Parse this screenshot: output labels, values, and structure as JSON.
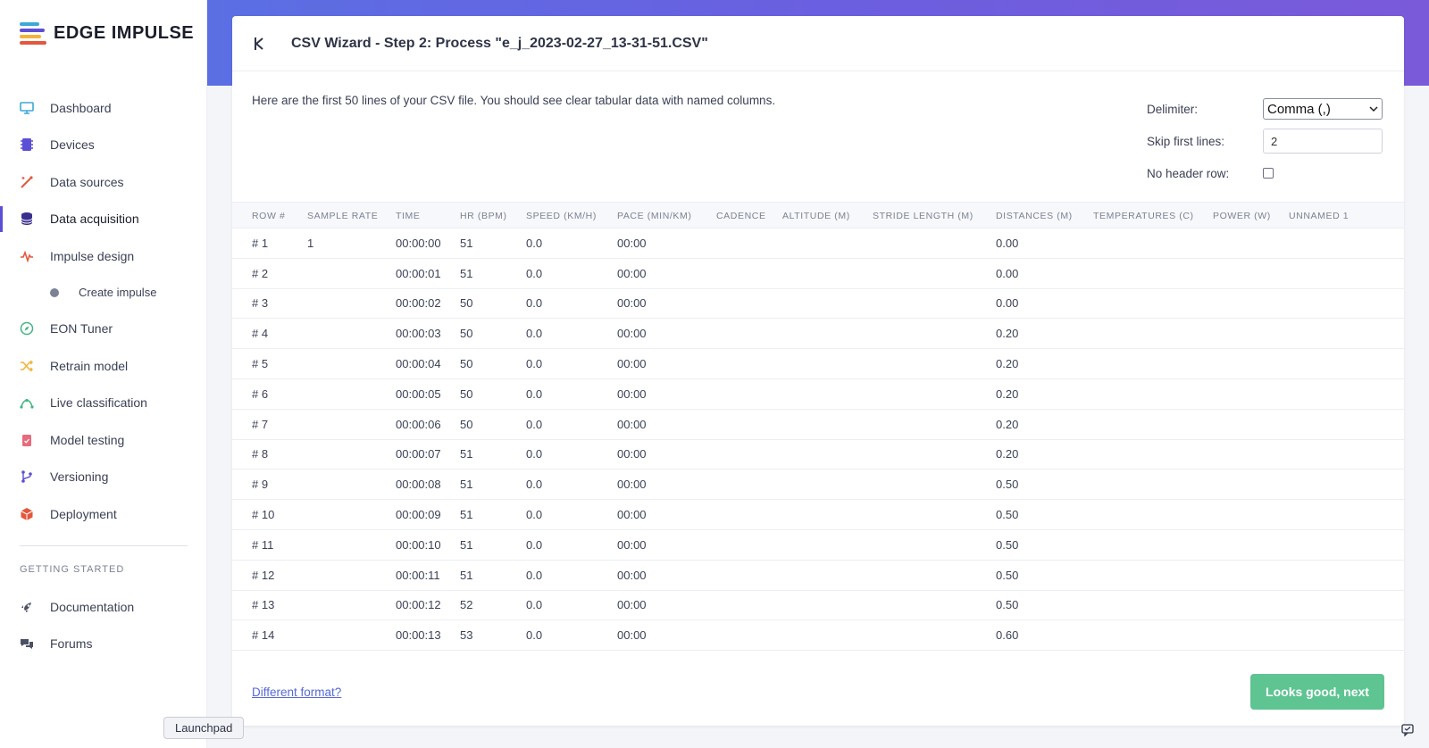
{
  "app": {
    "name": "EDGE IMPULSE",
    "colors": {
      "accent": "#5b4fd6",
      "primary_button": "#5ec491",
      "link": "#5668d6"
    }
  },
  "sidebar": {
    "items": [
      {
        "label": "Dashboard",
        "icon": "monitor-icon"
      },
      {
        "label": "Devices",
        "icon": "chip-icon"
      },
      {
        "label": "Data sources",
        "icon": "wand-icon"
      },
      {
        "label": "Data acquisition",
        "icon": "database-icon",
        "active": true
      },
      {
        "label": "Impulse design",
        "icon": "pulse-icon"
      }
    ],
    "sub_item": "Create impulse",
    "items_after": [
      {
        "label": "EON Tuner",
        "icon": "compass-icon"
      },
      {
        "label": "Retrain model",
        "icon": "shuffle-icon"
      },
      {
        "label": "Live classification",
        "icon": "curve-icon"
      },
      {
        "label": "Model testing",
        "icon": "clipboard-icon"
      },
      {
        "label": "Versioning",
        "icon": "branch-icon"
      },
      {
        "label": "Deployment",
        "icon": "box-icon"
      }
    ],
    "section_label": "GETTING STARTED",
    "getting_started": [
      {
        "label": "Documentation",
        "icon": "rocket-icon"
      },
      {
        "label": "Forums",
        "icon": "chat-icon"
      }
    ]
  },
  "wizard": {
    "title": "CSV Wizard - Step 2: Process \"e_j_2023-02-27_13-31-51.CSV\"",
    "intro": "Here are the first 50 lines of your CSV file. You should see clear tabular data with named columns.",
    "delimiter_label": "Delimiter:",
    "delimiter_value": "Comma (,)",
    "skip_label": "Skip first lines:",
    "skip_value": "2",
    "no_header_label": "No header row:",
    "no_header_checked": false,
    "columns": [
      "ROW #",
      "SAMPLE RATE",
      "TIME",
      "HR (BPM)",
      "SPEED (KM/H)",
      "PACE (MIN/KM)",
      "CADENCE",
      "ALTITUDE (M)",
      "STRIDE LENGTH (M)",
      "DISTANCES (M)",
      "TEMPERATURES (C)",
      "POWER (W)",
      "UNNAMED 1"
    ],
    "rows": [
      [
        "# 1",
        "1",
        "00:00:00",
        "51",
        "0.0",
        "00:00",
        "",
        "",
        "",
        "0.00",
        "",
        "",
        ""
      ],
      [
        "# 2",
        "",
        "00:00:01",
        "51",
        "0.0",
        "00:00",
        "",
        "",
        "",
        "0.00",
        "",
        "",
        ""
      ],
      [
        "# 3",
        "",
        "00:00:02",
        "50",
        "0.0",
        "00:00",
        "",
        "",
        "",
        "0.00",
        "",
        "",
        ""
      ],
      [
        "# 4",
        "",
        "00:00:03",
        "50",
        "0.0",
        "00:00",
        "",
        "",
        "",
        "0.20",
        "",
        "",
        ""
      ],
      [
        "# 5",
        "",
        "00:00:04",
        "50",
        "0.0",
        "00:00",
        "",
        "",
        "",
        "0.20",
        "",
        "",
        ""
      ],
      [
        "# 6",
        "",
        "00:00:05",
        "50",
        "0.0",
        "00:00",
        "",
        "",
        "",
        "0.20",
        "",
        "",
        ""
      ],
      [
        "# 7",
        "",
        "00:00:06",
        "50",
        "0.0",
        "00:00",
        "",
        "",
        "",
        "0.20",
        "",
        "",
        ""
      ],
      [
        "# 8",
        "",
        "00:00:07",
        "51",
        "0.0",
        "00:00",
        "",
        "",
        "",
        "0.20",
        "",
        "",
        ""
      ],
      [
        "# 9",
        "",
        "00:00:08",
        "51",
        "0.0",
        "00:00",
        "",
        "",
        "",
        "0.50",
        "",
        "",
        ""
      ],
      [
        "# 10",
        "",
        "00:00:09",
        "51",
        "0.0",
        "00:00",
        "",
        "",
        "",
        "0.50",
        "",
        "",
        ""
      ],
      [
        "# 11",
        "",
        "00:00:10",
        "51",
        "0.0",
        "00:00",
        "",
        "",
        "",
        "0.50",
        "",
        "",
        ""
      ],
      [
        "# 12",
        "",
        "00:00:11",
        "51",
        "0.0",
        "00:00",
        "",
        "",
        "",
        "0.50",
        "",
        "",
        ""
      ],
      [
        "# 13",
        "",
        "00:00:12",
        "52",
        "0.0",
        "00:00",
        "",
        "",
        "",
        "0.50",
        "",
        "",
        ""
      ],
      [
        "# 14",
        "",
        "00:00:13",
        "53",
        "0.0",
        "00:00",
        "",
        "",
        "",
        "0.60",
        "",
        "",
        ""
      ]
    ],
    "different_format_link": "Different format?",
    "next_button": "Looks good, next"
  },
  "tooltip": "Launchpad"
}
